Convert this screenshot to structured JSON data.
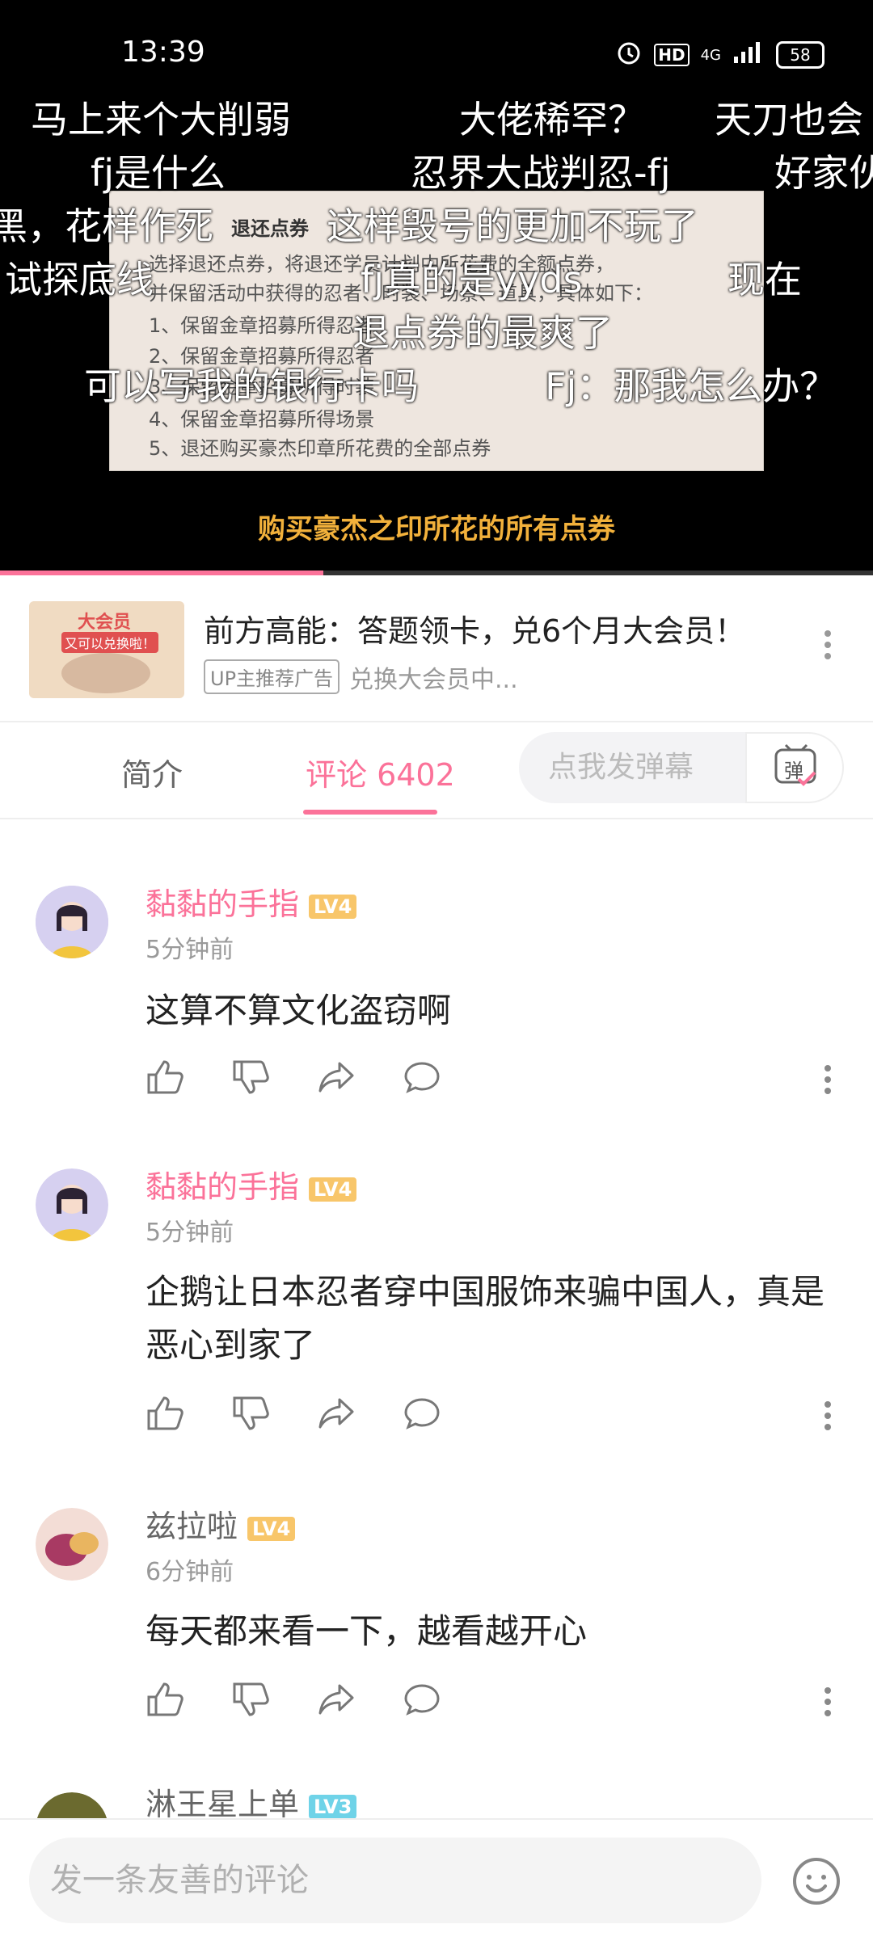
{
  "status_bar": {
    "time": "13:39",
    "network": "4G",
    "hd": "HD",
    "battery": "58"
  },
  "video": {
    "still_title": "退还点券",
    "still_lines": [
      "选择退还点券，将退还学员计划中所花费的全额点券，",
      "并保留活动中获得的忍者、时装、场景、道具，具体如下：",
      "1、保留金章招募所得忍者",
      "2、保留金章招募所得忍者",
      "3、保留金章招募所得时装",
      "4、保留金章招募所得场景",
      "5、退还购买豪杰印章所花费的全部点券"
    ],
    "caption": "购买豪杰之印所花的所有点券",
    "danmaku": [
      "马上来个大削弱",
      "大佬稀罕？",
      "天刀也会",
      "fj是什么",
      "忍界大战判忍-fj",
      "好家伙",
      "黑，花样作死",
      "这样毁号的更加不玩了",
      "试探底线",
      "fj真的是yyds",
      "现在",
      "退点券的最爽了",
      "可以写我的银行卡吗",
      "Fj：那我怎么办？"
    ],
    "progress": 0.37
  },
  "ad": {
    "title": "前方高能：答题领卡，兑6个月大会员！",
    "tag": "UP主推荐广告",
    "subtitle": "兑换大会员中...",
    "thumb_text_1": "大会员",
    "thumb_text_2": "又可以兑换啦！"
  },
  "tabs": {
    "intro": "简介",
    "comments": "评论 6402",
    "danmaku_placeholder": "点我发弹幕",
    "danmaku_icon_label": "弹"
  },
  "comments": [
    {
      "user": "黏黏的手指",
      "level": "LV4",
      "level_color": "#f8c66a",
      "vip": true,
      "time": "5分钟前",
      "text": "这算不算文化盗窃啊"
    },
    {
      "user": "黏黏的手指",
      "level": "LV4",
      "level_color": "#f8c66a",
      "vip": true,
      "time": "5分钟前",
      "text": "企鹅让日本忍者穿中国服饰来骗中国人，真是恶心到家了"
    },
    {
      "user": "兹拉啦",
      "level": "LV4",
      "level_color": "#f8c66a",
      "vip": false,
      "time": "6分钟前",
      "text": "每天都来看一下，越看越开心"
    },
    {
      "user": "淋王星上单",
      "level": "LV3",
      "level_color": "#6fd3e8",
      "vip": false,
      "time": "",
      "text": ""
    }
  ],
  "bottom": {
    "placeholder": "发一条友善的评论"
  },
  "colors": {
    "accent": "#fb7299",
    "caption": "#f2b13b"
  }
}
